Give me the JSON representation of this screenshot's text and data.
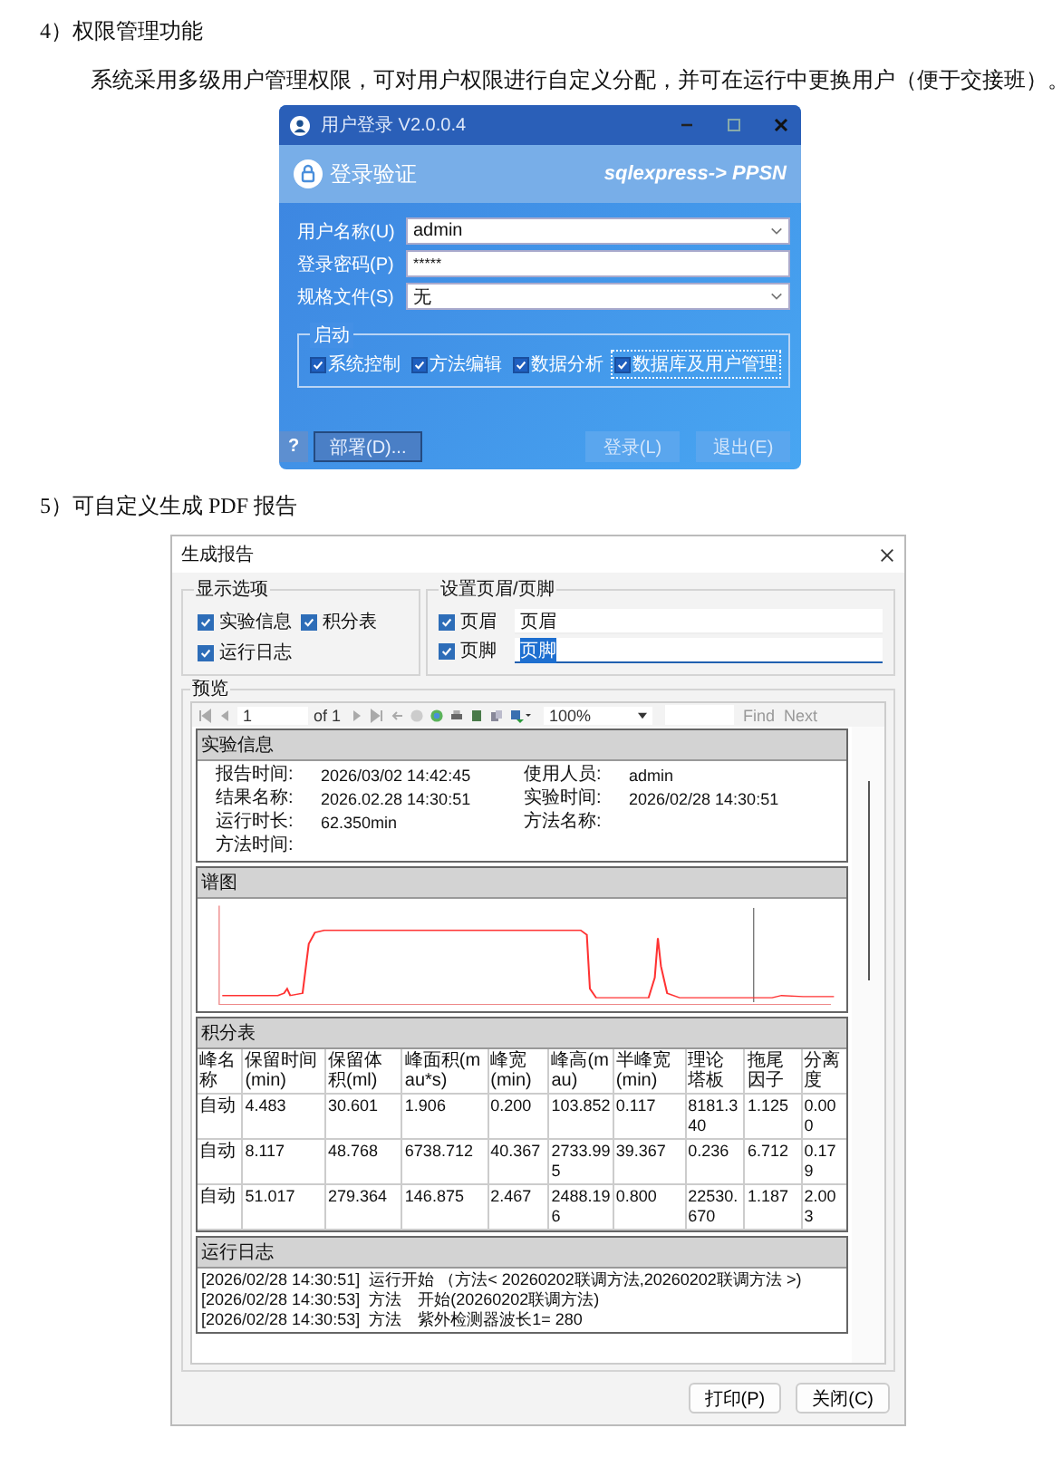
{
  "section_1": {
    "heading": "4）权限管理功能",
    "paragraph": "系统采用多级用户管理权限，可对用户权限进行自定义分配，并可在运行中更换用户（便于交接班）。"
  },
  "login_dialog": {
    "title": "用户登录 V2.0.0.4",
    "header": "登录验证",
    "server": "sqlexpress-> PPSN",
    "fields": [
      {
        "label": "用户名称(U)",
        "value": "admin",
        "kind": "dropdown"
      },
      {
        "label": "登录密码(P)",
        "value": "*****",
        "kind": "password"
      },
      {
        "label": "规格文件(S)",
        "value": "无",
        "kind": "dropdown"
      }
    ],
    "startup": {
      "title": "启动",
      "items": [
        {
          "label": "系统控制",
          "checked": true,
          "focused": false
        },
        {
          "label": "方法编辑",
          "checked": true,
          "focused": false
        },
        {
          "label": "数据分析",
          "checked": true,
          "focused": false
        },
        {
          "label": "数据库及用户管理",
          "checked": true,
          "focused": true
        }
      ]
    },
    "help_button": "?",
    "deploy_button": "部署(D)...",
    "buttons": [
      "登录(L)",
      "退出(E)"
    ]
  },
  "section_2": {
    "heading": "5）可自定义生成 PDF 报告"
  },
  "report_dialog": {
    "title": "生成报告",
    "display_options": {
      "title": "显示选项",
      "items": [
        {
          "label": "实验信息",
          "checked": true
        },
        {
          "label": "积分表",
          "checked": true
        },
        {
          "label": "运行日志",
          "checked": true
        }
      ]
    },
    "header_footer": {
      "title": "设置页眉/页脚",
      "items": [
        {
          "label": "页眉",
          "checked": true,
          "value": "页眉",
          "text_selected": false
        },
        {
          "label": "页脚",
          "checked": true,
          "value": "页脚",
          "text_selected": true
        }
      ]
    },
    "preview": {
      "title": "预览",
      "toolbar": {
        "page": "1",
        "of": "of 1",
        "zoom": "100%",
        "find": "Find",
        "next": "Next"
      },
      "info": {
        "title": "实验信息",
        "pairs": [
          {
            "label": "报告时间:",
            "value": "2026/03/02 14:42:45"
          },
          {
            "label": "使用人员:",
            "value": "admin"
          },
          {
            "label": "结果名称:",
            "value": "2026.02.28 14:30:51"
          },
          {
            "label": "实验时间:",
            "value": "2026/02/28 14:30:51"
          },
          {
            "label": "运行时长:",
            "value": "62.350min"
          },
          {
            "label": "方法名称:"
          },
          {
            "label": "方法时间:"
          }
        ]
      },
      "chromatogram": {
        "title": "谱图"
      },
      "table": {
        "title": "积分表",
        "columns": [
          "峰名称",
          "保留时间(min)",
          "保留体积(ml)",
          "峰面积(mau*s)",
          "峰宽(min)",
          "峰高(mau)",
          "半峰宽(min)",
          "理论塔板",
          "拖尾因子",
          "分离度"
        ],
        "rows": [
          [
            "自动",
            "4.483",
            "30.601",
            "1.906",
            "0.200",
            "103.852",
            "0.117",
            "8181.340",
            "1.125",
            "0.000"
          ],
          [
            "自动",
            "8.117",
            "48.768",
            "6738.712",
            "40.367",
            "2733.995",
            "39.367",
            "0.236",
            "6.712",
            "0.179"
          ],
          [
            "自动",
            "51.017",
            "279.364",
            "146.875",
            "2.467",
            "2488.196",
            "0.800",
            "22530.670",
            "1.187",
            "2.003"
          ]
        ]
      },
      "log": {
        "title": "运行日志",
        "lines": [
          {
            "time": "[2026/02/28 14:30:51]",
            "text": "运行开始 （方法< 20260202联调方法,20260202联调方法 >)"
          },
          {
            "time": "[2026/02/28 14:30:53]",
            "text": "方法　开始(20260202联调方法)"
          },
          {
            "time": "[2026/02/28 14:30:53]",
            "text": "方法　紫外检测器波长1= 280"
          }
        ]
      }
    },
    "buttons": [
      "打印(P)",
      "关闭(C)"
    ]
  }
}
